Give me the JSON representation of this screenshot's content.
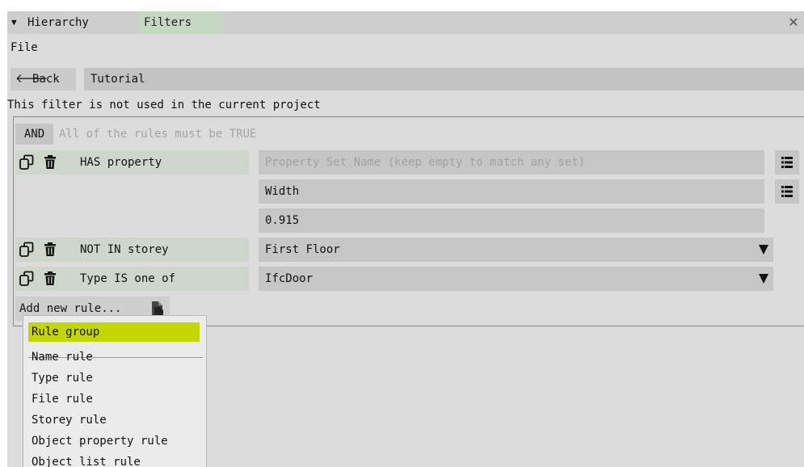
{
  "tabs": [
    {
      "label": "Hierarchy",
      "active": false
    },
    {
      "label": "Filters",
      "active": true
    }
  ],
  "menu": {
    "file": "File"
  },
  "toolbar": {
    "back_label": "Back",
    "filter_name": "Tutorial"
  },
  "notice": "This filter is not used in the current project",
  "group": {
    "operator": "AND",
    "description": "All of the rules must be TRUE"
  },
  "rules": [
    {
      "label": "HAS property",
      "property_set_placeholder": "Property Set Name (keep empty to match any set)",
      "property_name": "Width",
      "value": "0.915"
    },
    {
      "label": "NOT IN storey",
      "value": "First Floor"
    },
    {
      "label": "Type IS one of",
      "value": "IfcDoor"
    }
  ],
  "add_rule_label": "Add new rule...",
  "dropdown": {
    "items": [
      "Rule group",
      "Name rule",
      "Type rule",
      "File rule",
      "Storey rule",
      "Object property rule",
      "Object list rule"
    ],
    "highlighted": "Rule group"
  },
  "colors": {
    "panel_bg": "#dcdcdc",
    "active_tab": "#c5d9c2",
    "highlight": "#c4d600",
    "rule_label_bg": "#cfd6cc"
  },
  "icons": [
    "chevron-down-icon",
    "close-icon",
    "arrow-left-icon",
    "copy-icon",
    "trash-icon",
    "list-icon",
    "combo-arrow-icon",
    "paste-icon"
  ]
}
